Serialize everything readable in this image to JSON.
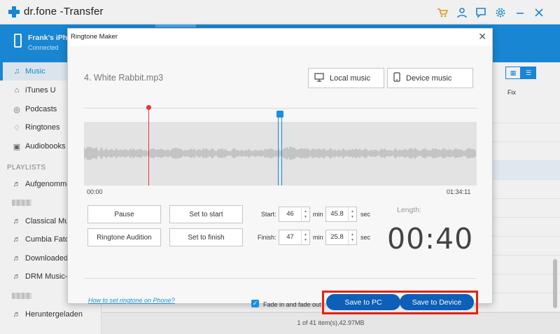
{
  "app": {
    "title": "dr.fone -Transfer"
  },
  "device": {
    "name": "Frank's iPho",
    "status": "Connected"
  },
  "sidebar": {
    "items": [
      {
        "label": "Music",
        "icon": "music-note-icon"
      },
      {
        "label": "iTunes U",
        "icon": "graduation-icon"
      },
      {
        "label": "Podcasts",
        "icon": "podcast-icon"
      },
      {
        "label": "Ringtones",
        "icon": "bell-icon"
      },
      {
        "label": "Audiobooks",
        "icon": "book-icon"
      }
    ],
    "playlists_header": "PLAYLISTS",
    "playlists": [
      {
        "label": "Aufgenomme"
      },
      {
        "label": ""
      },
      {
        "label": "Classical Mus"
      },
      {
        "label": "Cumbia Fato"
      },
      {
        "label": "Downloaded"
      },
      {
        "label": "DRM Music-P"
      },
      {
        "label": ""
      },
      {
        "label": "Heruntergeladen"
      }
    ]
  },
  "main": {
    "fix_column": "Fix",
    "status": "1 of 41 item(s),42.97MB"
  },
  "dialog": {
    "title": "Ringtone Maker",
    "track": "4. White Rabbit.mp3",
    "local_music": "Local music",
    "device_music": "Device music",
    "time_start": "00:00",
    "time_end": "01:34:11",
    "pause": "Pause",
    "set_to_start": "Set to start",
    "ringtone_audition": "Ringtone Audition",
    "set_to_finish": "Set to finish",
    "start_label": "Start:",
    "finish_label": "Finish:",
    "start_min": "46",
    "start_sec": "45.8",
    "finish_min": "47",
    "finish_sec": "25.8",
    "min_unit": "min",
    "sec_unit": "sec",
    "length_label": "Length:",
    "length_value": "00:40",
    "help_link": "How to set ringtone on Phone?",
    "fade_label": "Fade in and fade out",
    "fade_checked": true,
    "save_pc": "Save to PC",
    "save_device": "Save to Device"
  },
  "colors": {
    "accent": "#1a8fe0",
    "save": "#0d5fb8",
    "highlight": "#e8220f",
    "red_marker": "#e53935"
  }
}
